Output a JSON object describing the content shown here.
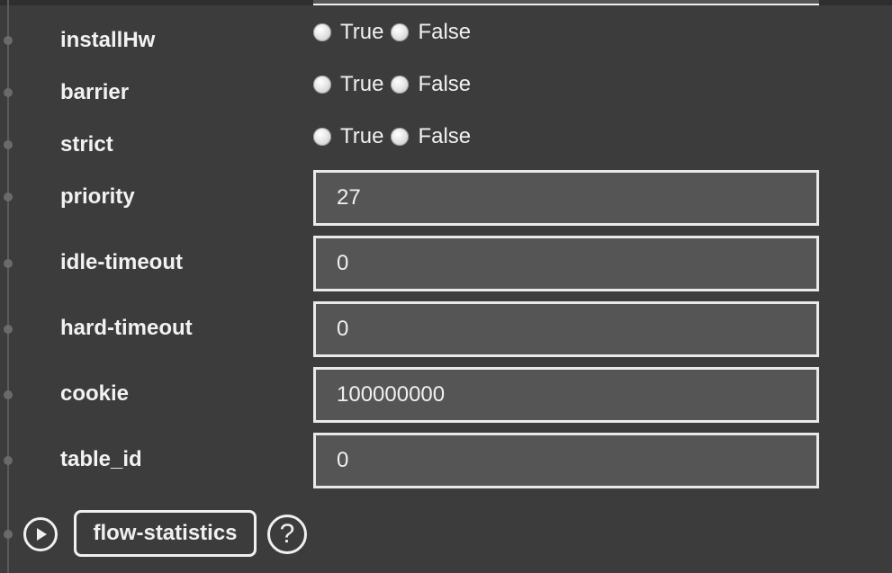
{
  "rows": [
    {
      "label": "installHw",
      "type": "radio",
      "options": [
        "True",
        "False"
      ]
    },
    {
      "label": "barrier",
      "type": "radio",
      "options": [
        "True",
        "False"
      ]
    },
    {
      "label": "strict",
      "type": "radio",
      "options": [
        "True",
        "False"
      ]
    },
    {
      "label": "priority",
      "type": "text",
      "value": "27"
    },
    {
      "label": "idle-timeout",
      "type": "text",
      "value": "0"
    },
    {
      "label": "hard-timeout",
      "type": "text",
      "value": "0"
    },
    {
      "label": "cookie",
      "type": "text",
      "value": "100000000"
    },
    {
      "label": "table_id",
      "type": "text",
      "value": "0"
    }
  ],
  "footer": {
    "play_icon": "play-circle-icon",
    "button_label": "flow-statistics",
    "help_icon": "question-circle-icon",
    "help_glyph": "?"
  }
}
